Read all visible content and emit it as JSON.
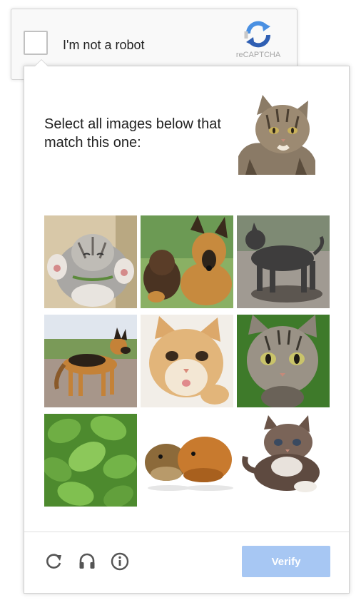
{
  "anchor": {
    "checkbox_label": "I'm not a robot",
    "logo_text": "reCAPTCHA",
    "logo_icon": "recaptcha-logo-icon"
  },
  "challenge": {
    "instructions": "Select all images below that match this one:",
    "sample_image": "tabby-cat",
    "tiles": [
      {
        "content": "kitten-lying-on-back"
      },
      {
        "content": "german-shepherd-dogs"
      },
      {
        "content": "grey-dog-standing"
      },
      {
        "content": "german-shepherd-on-road"
      },
      {
        "content": "ginger-kitten"
      },
      {
        "content": "tabby-kitten-on-green"
      },
      {
        "content": "green-leaves"
      },
      {
        "content": "guinea-pigs"
      },
      {
        "content": "fluffy-kitten"
      }
    ]
  },
  "footer": {
    "reload_icon": "reload-icon",
    "audio_icon": "headphones-icon",
    "info_icon": "info-icon",
    "verify_label": "Verify"
  },
  "colors": {
    "verify_button": "#a7c7f3",
    "logo_blue": "#4a90e2",
    "logo_grey": "#a6a6a6"
  }
}
